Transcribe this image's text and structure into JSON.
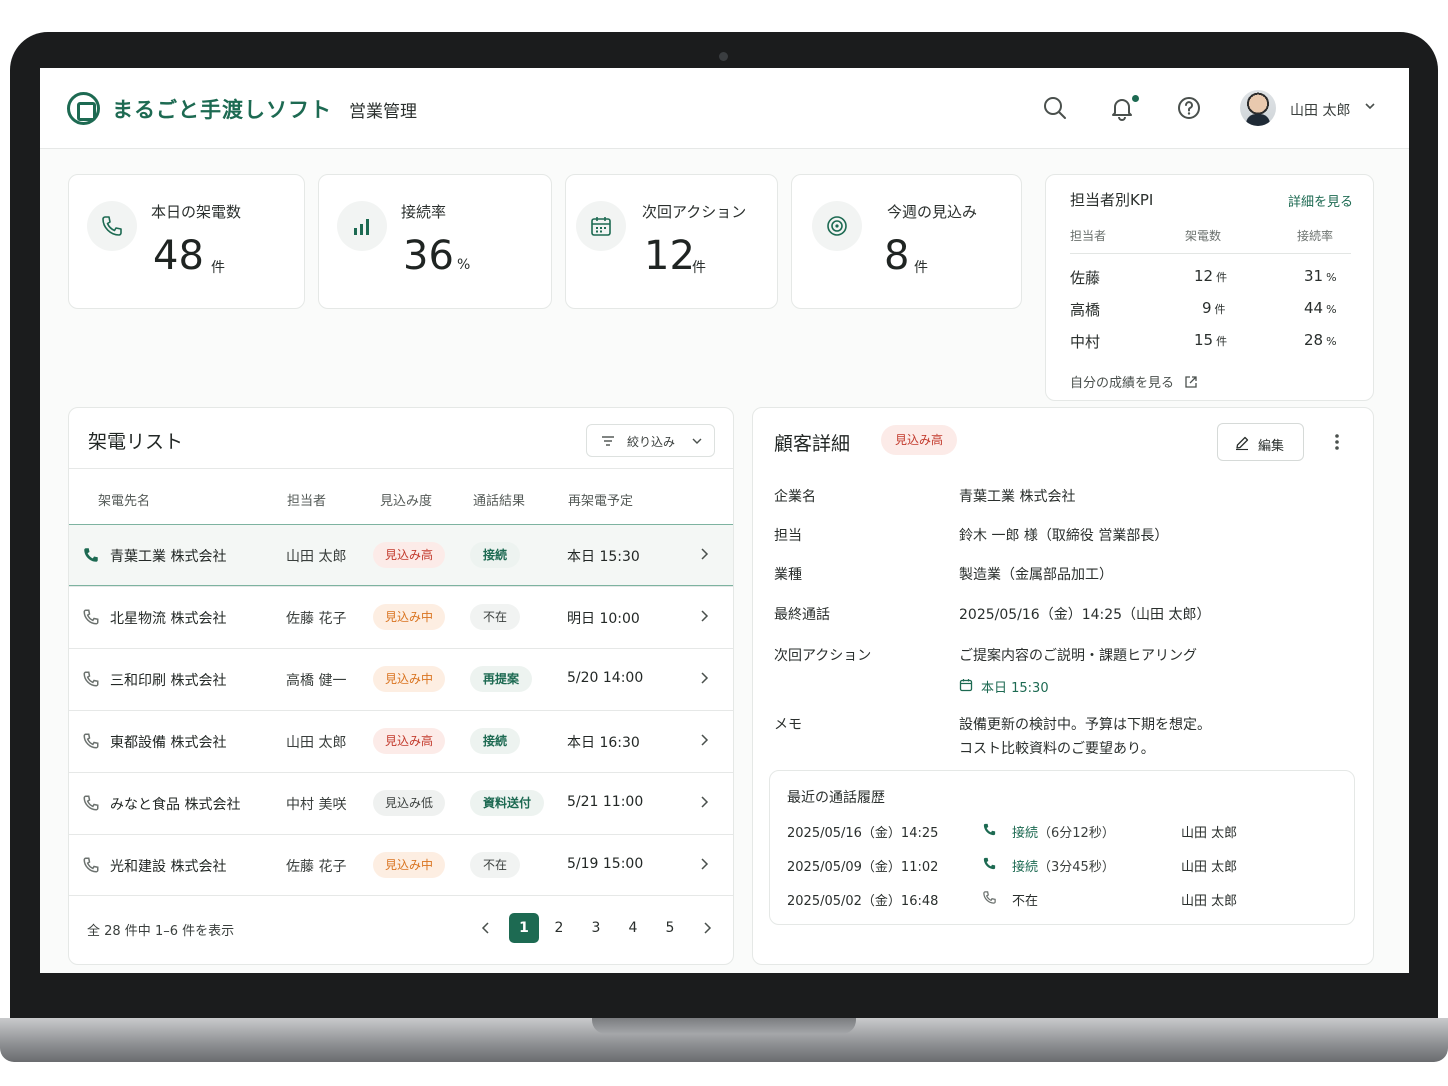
{
  "header": {
    "brand": "まるごと手渡しソフト",
    "module": "営業管理",
    "user_name": "山田 太郎",
    "icons": [
      "search-icon",
      "bell-icon",
      "help-icon",
      "chevron-down-icon"
    ]
  },
  "stats": [
    {
      "label": "本日の架電数",
      "value": "48",
      "unit": "件",
      "icon": "phone-icon"
    },
    {
      "label": "接続率",
      "value": "36",
      "unit": "%",
      "icon": "bar-chart-icon"
    },
    {
      "label": "次回アクション",
      "value": "12",
      "unit": "件",
      "icon": "calendar-icon"
    },
    {
      "label": "今週の見込み",
      "value": "8",
      "unit": "件",
      "icon": "target-icon"
    }
  ],
  "kpi": {
    "title": "担当者別KPI",
    "link": "詳細を見る",
    "headers": [
      "担当者",
      "架電数",
      "接続率"
    ],
    "rows": [
      {
        "name": "佐藤",
        "calls": "12",
        "calls_unit": "件",
        "rate": "31",
        "rate_unit": "%"
      },
      {
        "name": "高橋",
        "calls": "9",
        "calls_unit": "件",
        "rate": "44",
        "rate_unit": "%"
      },
      {
        "name": "中村",
        "calls": "15",
        "calls_unit": "件",
        "rate": "28",
        "rate_unit": "%"
      }
    ],
    "footer": "自分の成績を見る"
  },
  "call_list": {
    "title": "架電リスト",
    "filter_label": "絞り込み",
    "columns": [
      "架電先名",
      "担当者",
      "見込み度",
      "通話結果",
      "再架電予定"
    ],
    "rows": [
      {
        "company": "青葉工業 株式会社",
        "owner": "山田 太郎",
        "prospect": "見込み高",
        "result": "接続",
        "next": "本日 15:30"
      },
      {
        "company": "北星物流 株式会社",
        "owner": "佐藤 花子",
        "prospect": "見込み中",
        "result": "不在",
        "next": "明日 10:00"
      },
      {
        "company": "三和印刷 株式会社",
        "owner": "高橋 健一",
        "prospect": "見込み中",
        "result": "再提案",
        "next": "5/20 14:00"
      },
      {
        "company": "東都設備 株式会社",
        "owner": "山田 太郎",
        "prospect": "見込み高",
        "result": "接続",
        "next": "本日 16:30"
      },
      {
        "company": "みなと食品 株式会社",
        "owner": "中村 美咲",
        "prospect": "見込み低",
        "result": "資料送付",
        "next": "5/21 11:00"
      },
      {
        "company": "光和建設 株式会社",
        "owner": "佐藤 花子",
        "prospect": "見込み中",
        "result": "不在",
        "next": "5/19 15:00"
      }
    ],
    "footer": "全 28 件中 1–6 件を表示",
    "pages": [
      "1",
      "2",
      "3",
      "4",
      "5"
    ],
    "current_page": "1"
  },
  "detail": {
    "title": "顧客詳細",
    "badge": "見込み高",
    "edit_label": "編集",
    "fields": {
      "company_label": "企業名",
      "company": "青葉工業 株式会社",
      "contact_label": "担当",
      "contact": "鈴木 一郎 様（取締役 営業部長）",
      "industry_label": "業種",
      "industry": "製造業（金属部品加工）",
      "last_call_label": "最終通話",
      "last_call": "2025/05/16（金）14:25（山田 太郎）",
      "next_action_label": "次回アクション",
      "next_action": "ご提案内容のご説明・課題ヒアリング",
      "next_action_time": "本日 15:30",
      "memo_label": "メモ",
      "memo_line1": "設備更新の検討中。予算は下期を想定。",
      "memo_line2": "コスト比較資料のご要望あり。"
    },
    "history": {
      "title": "最近の通話履歴",
      "rows": [
        {
          "date": "2025/05/16（金）14:25",
          "result": "接続",
          "duration": "（6分12秒）",
          "user": "山田 太郎"
        },
        {
          "date": "2025/05/09（金）11:02",
          "result": "接続",
          "duration": "（3分45秒）",
          "user": "山田 太郎"
        },
        {
          "date": "2025/05/02（金）16:48",
          "result": "不在",
          "duration": "",
          "user": "山田 太郎"
        }
      ]
    }
  },
  "colors": {
    "accent": "#1d6a52",
    "high": "#c2392b",
    "mid": "#d9731f"
  }
}
